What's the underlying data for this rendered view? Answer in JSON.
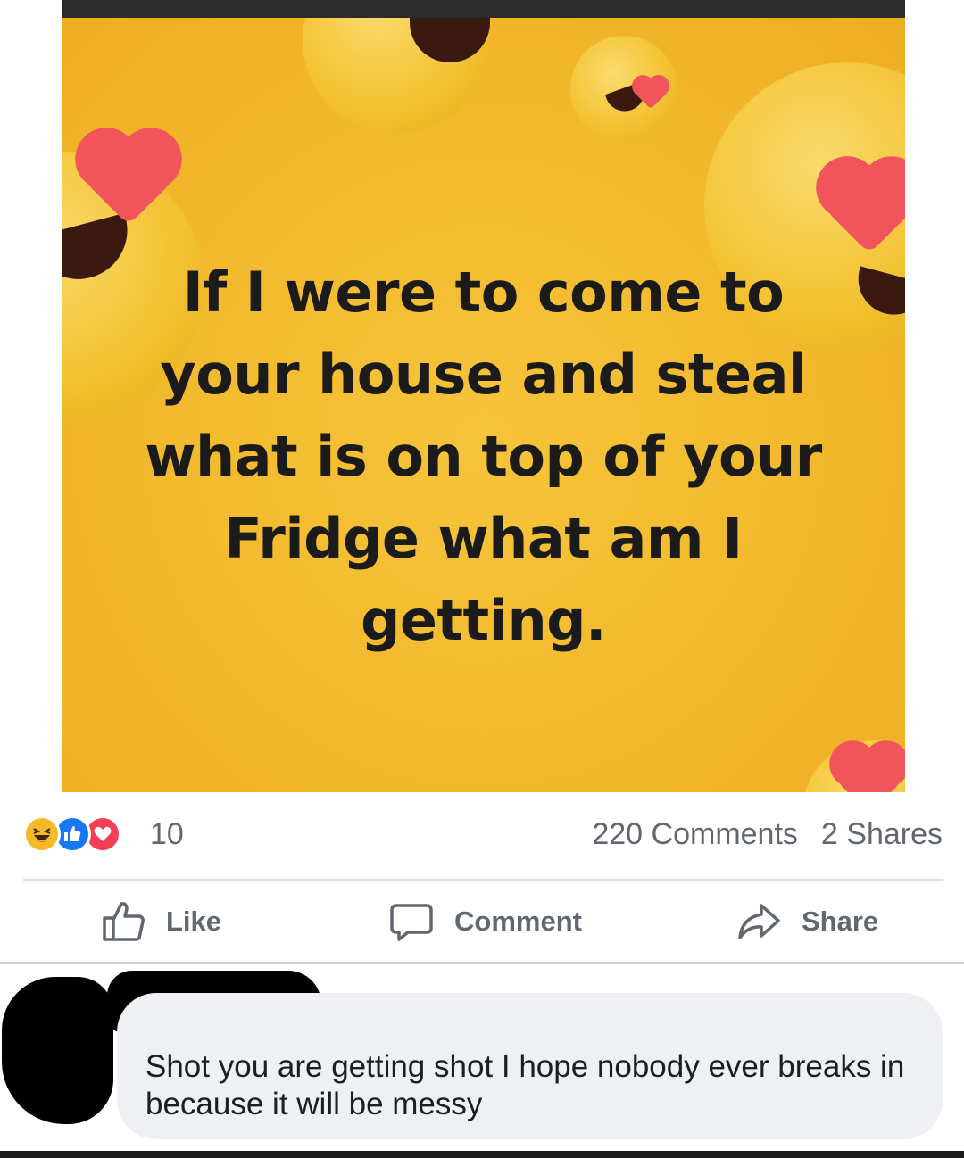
{
  "post": {
    "image_text": {
      "line1": "If I were to come to",
      "line2": "your house and steal",
      "line3": "what is on top of your",
      "line4": "Fridge what am I",
      "line5": "getting."
    },
    "background_color": "#f2b92c"
  },
  "stats": {
    "reactions": [
      "haha-icon",
      "like-icon",
      "love-icon"
    ],
    "reaction_count": "10",
    "comments": "220 Comments",
    "shares": "2 Shares"
  },
  "actions": {
    "like": "Like",
    "comment": "Comment",
    "share": "Share"
  },
  "comment": {
    "text": "Shot you are getting shot I hope nobody ever breaks in because it will be messy"
  },
  "colors": {
    "like_blue": "#1877f2",
    "love_red": "#f33e58",
    "haha_yellow": "#f7b928",
    "muted_text": "#606770",
    "bubble_bg": "#eef0f3"
  }
}
